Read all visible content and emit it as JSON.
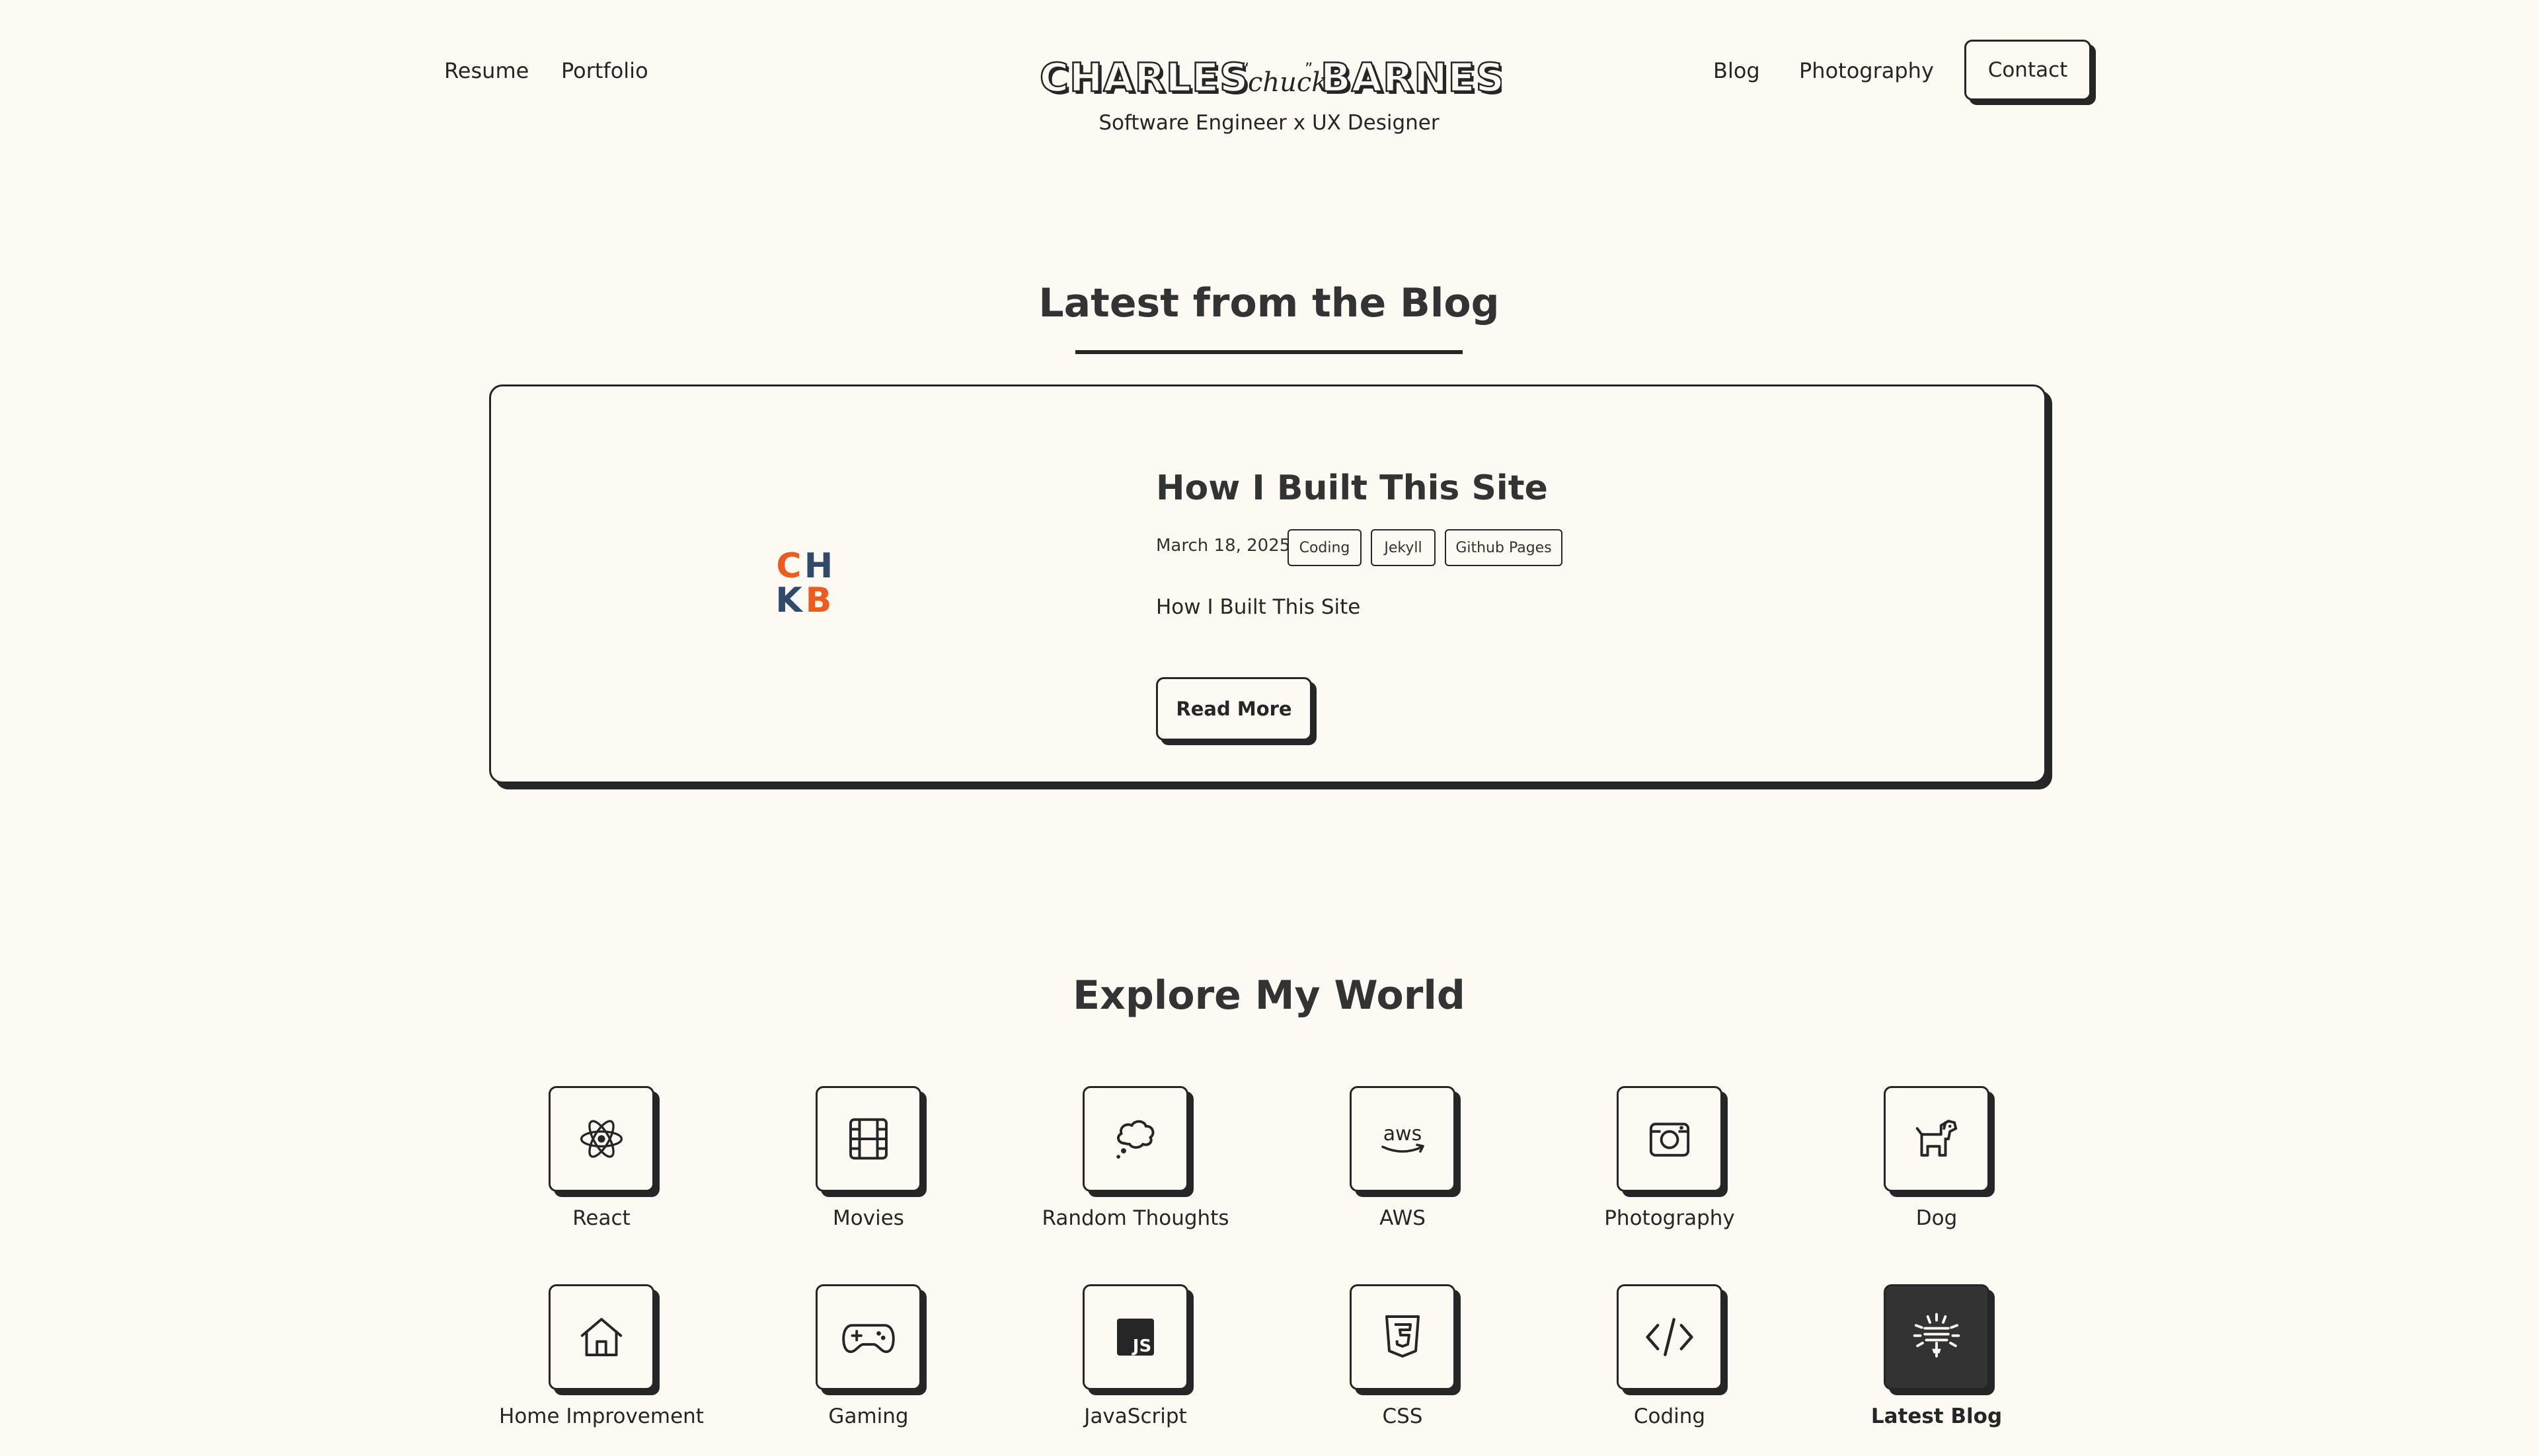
{
  "nav": {
    "left": [
      {
        "label": "Resume"
      },
      {
        "label": "Portfolio"
      }
    ],
    "right": [
      {
        "label": "Blog"
      },
      {
        "label": "Photography"
      }
    ],
    "contact_label": "Contact"
  },
  "brand": {
    "logo_text": "CHARLES chuck BARNES",
    "tagline": "Software Engineer x UX Designer"
  },
  "blog_section": {
    "title": "Latest from the Blog",
    "post": {
      "thumbnail_letters": [
        "C",
        "H",
        "K",
        "B"
      ],
      "title": "How I Built This Site",
      "date": "March 18, 2025",
      "tags": [
        "Coding",
        "Jekyll",
        "Github Pages"
      ],
      "excerpt": "How I Built This Site",
      "read_more_label": "Read More"
    }
  },
  "explore_section": {
    "title": "Explore My World",
    "categories": [
      {
        "label": "React",
        "icon": "react-icon"
      },
      {
        "label": "Movies",
        "icon": "film-icon"
      },
      {
        "label": "Random Thoughts",
        "icon": "thought-bubble-icon"
      },
      {
        "label": "AWS",
        "icon": "aws-icon"
      },
      {
        "label": "Photography",
        "icon": "camera-icon"
      },
      {
        "label": "Dog",
        "icon": "dog-icon"
      },
      {
        "label": "Home Improvement",
        "icon": "home-icon"
      },
      {
        "label": "Gaming",
        "icon": "gamepad-icon"
      },
      {
        "label": "JavaScript",
        "icon": "javascript-icon"
      },
      {
        "label": "CSS",
        "icon": "css-icon"
      },
      {
        "label": "Coding",
        "icon": "code-icon"
      },
      {
        "label": "Latest Blog",
        "icon": "fireworks-icon",
        "active": true
      }
    ]
  },
  "colors": {
    "background": "#fdf9f3",
    "ink": "#262626",
    "logo_orange": "#f05a1a",
    "logo_blue": "#2f4a6b"
  }
}
